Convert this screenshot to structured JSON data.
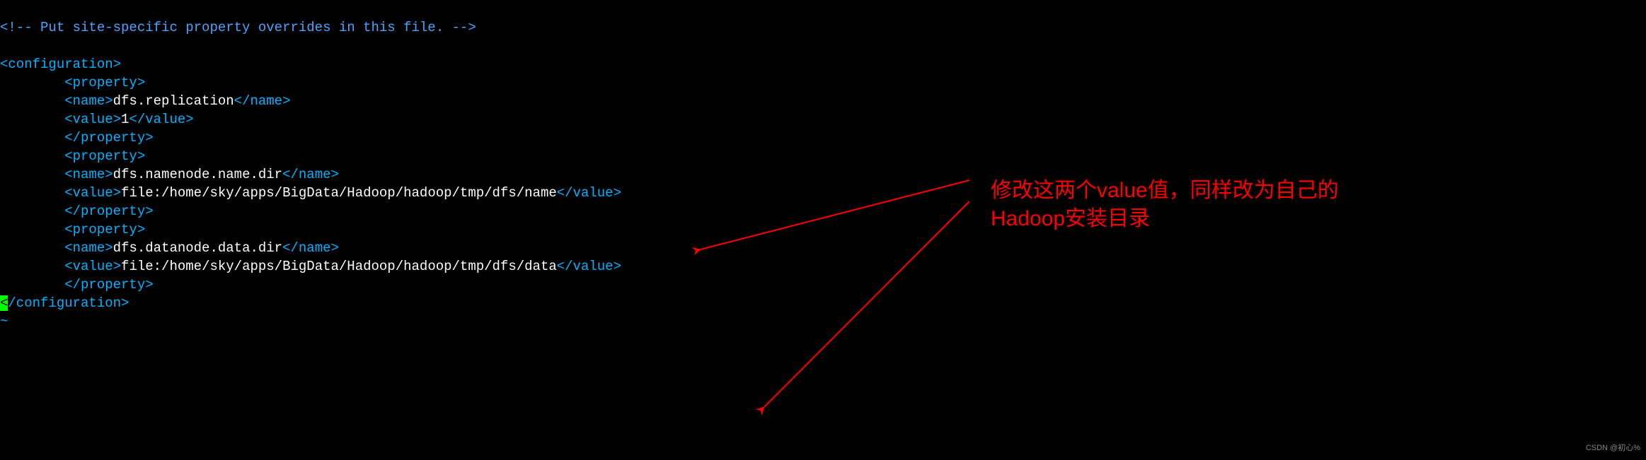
{
  "code": {
    "l1_open": "<!--",
    "l1_text": " Put site-specific property overrides in this file. ",
    "l1_close": "-->",
    "cfg_open": "<configuration>",
    "prop_open": "<property>",
    "prop_close": "</property>",
    "name_open": "<name>",
    "name_close": "</name>",
    "val_open": "<value>",
    "val_close": "</value>",
    "cfg_close_a": "<",
    "cfg_close_b": "/configuration>",
    "tilde": "~",
    "name1": "dfs.replication",
    "val1": "1",
    "name2": "dfs.namenode.name.dir",
    "val2": "file:/home/sky/apps/BigData/Hadoop/hadoop/tmp/dfs/name",
    "name3": "dfs.datanode.data.dir",
    "val3": "file:/home/sky/apps/BigData/Hadoop/hadoop/tmp/dfs/data"
  },
  "annotation": {
    "line1": "修改这两个value值，同样改为自己的",
    "line2": "Hadoop安装目录"
  },
  "watermark": "CSDN @初心%"
}
